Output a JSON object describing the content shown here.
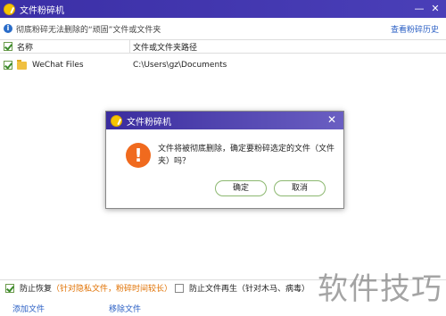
{
  "window": {
    "title": "文件粉碎机",
    "controls": [
      "—",
      "✕"
    ]
  },
  "infobar": {
    "message": "彻底粉碎无法删除的“顽固”文件或文件夹",
    "history_link": "查看粉碎历史"
  },
  "table": {
    "headers": {
      "name": "名称",
      "path": "文件或文件夹路径"
    },
    "rows": [
      {
        "checked": true,
        "name": "WeChat Files",
        "path": "C:\\Users\\gz\\Documents"
      }
    ]
  },
  "dialog": {
    "title": "文件粉碎机",
    "message": "文件将被彻底删除，确定要粉碎选定的文件（文件夹）吗？",
    "ok_label": "确定",
    "cancel_label": "取消",
    "icon": "warning-icon"
  },
  "options": {
    "prevent_restore": {
      "checked": true,
      "label": "防止恢复",
      "note": "（针对隐私文件，粉碎时间较长）"
    },
    "prevent_regen": {
      "checked": false,
      "label": "防止文件再生",
      "note": "（针对木马、病毒）"
    }
  },
  "bottom": {
    "add_label": "添加文件",
    "remove_label": "移除文件"
  },
  "watermark": "软件技巧",
  "colors": {
    "titlebar": "#3b2fa6",
    "link": "#2a5fc4",
    "warning": "#f06a1e",
    "accent_green": "#3a8a2a"
  }
}
